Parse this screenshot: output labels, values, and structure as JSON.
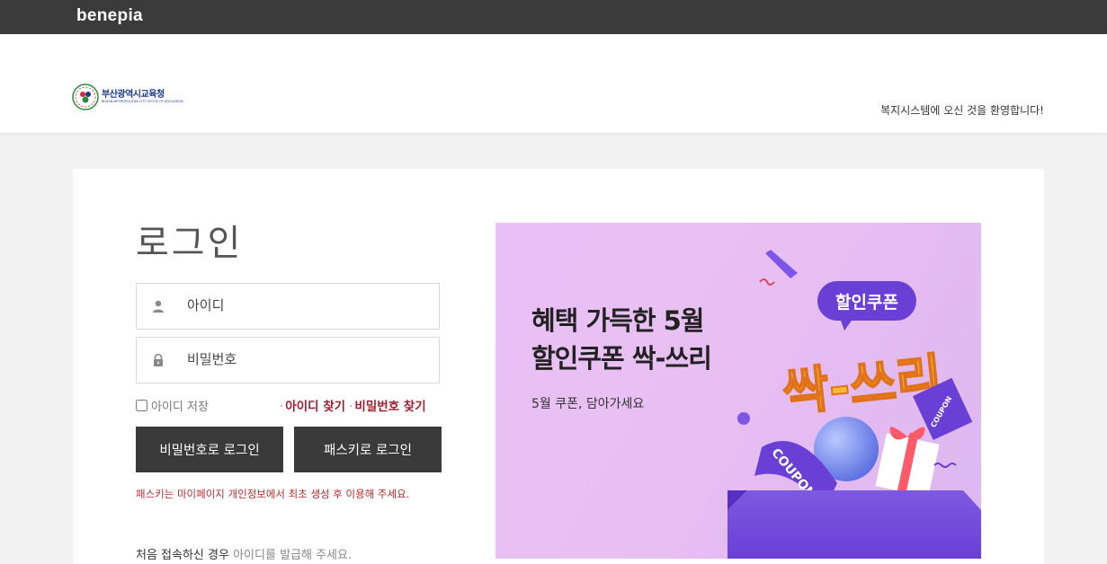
{
  "topbar": {
    "brand": "benepia"
  },
  "header": {
    "org_name": "부산광역시교육청",
    "org_sub": "BUSAN METROPOLITAN CITY OFFICE OF EDUCATION",
    "welcome": "복지시스템에 오신 것을 환영합니다!"
  },
  "login": {
    "title": "로그인",
    "id_placeholder": "아이디",
    "pw_placeholder": "비밀번호",
    "remember_label": "아이디 저장",
    "find_id": "아이디 찾기",
    "find_pw": "비밀번호 찾기",
    "btn_password": "비밀번호로 로그인",
    "btn_passkey": "패스키로 로그인",
    "passkey_notice": "패스키는 마이페이지 개인정보에서 최초 생성 후 이용해 주세요.",
    "first_visit_prefix": "처음 접속하신 경우",
    "first_visit_suffix": "아이디를 발급해 주세요."
  },
  "banner": {
    "line1": "혜택 가득한 5월",
    "line2": "할인쿠폰 싹-쓰리",
    "sub": "5월 쿠폰, 담아가세요",
    "bubble": "할인쿠폰",
    "big_text": "싹-쓰리",
    "coupon_left": "COUPON",
    "coupon_right": "COUPON"
  },
  "colors": {
    "accent_red": "#a51c30",
    "button_dark": "#3a3a3a",
    "topbar": "#3b3b3b",
    "banner_pink": "#e9c1f6"
  }
}
